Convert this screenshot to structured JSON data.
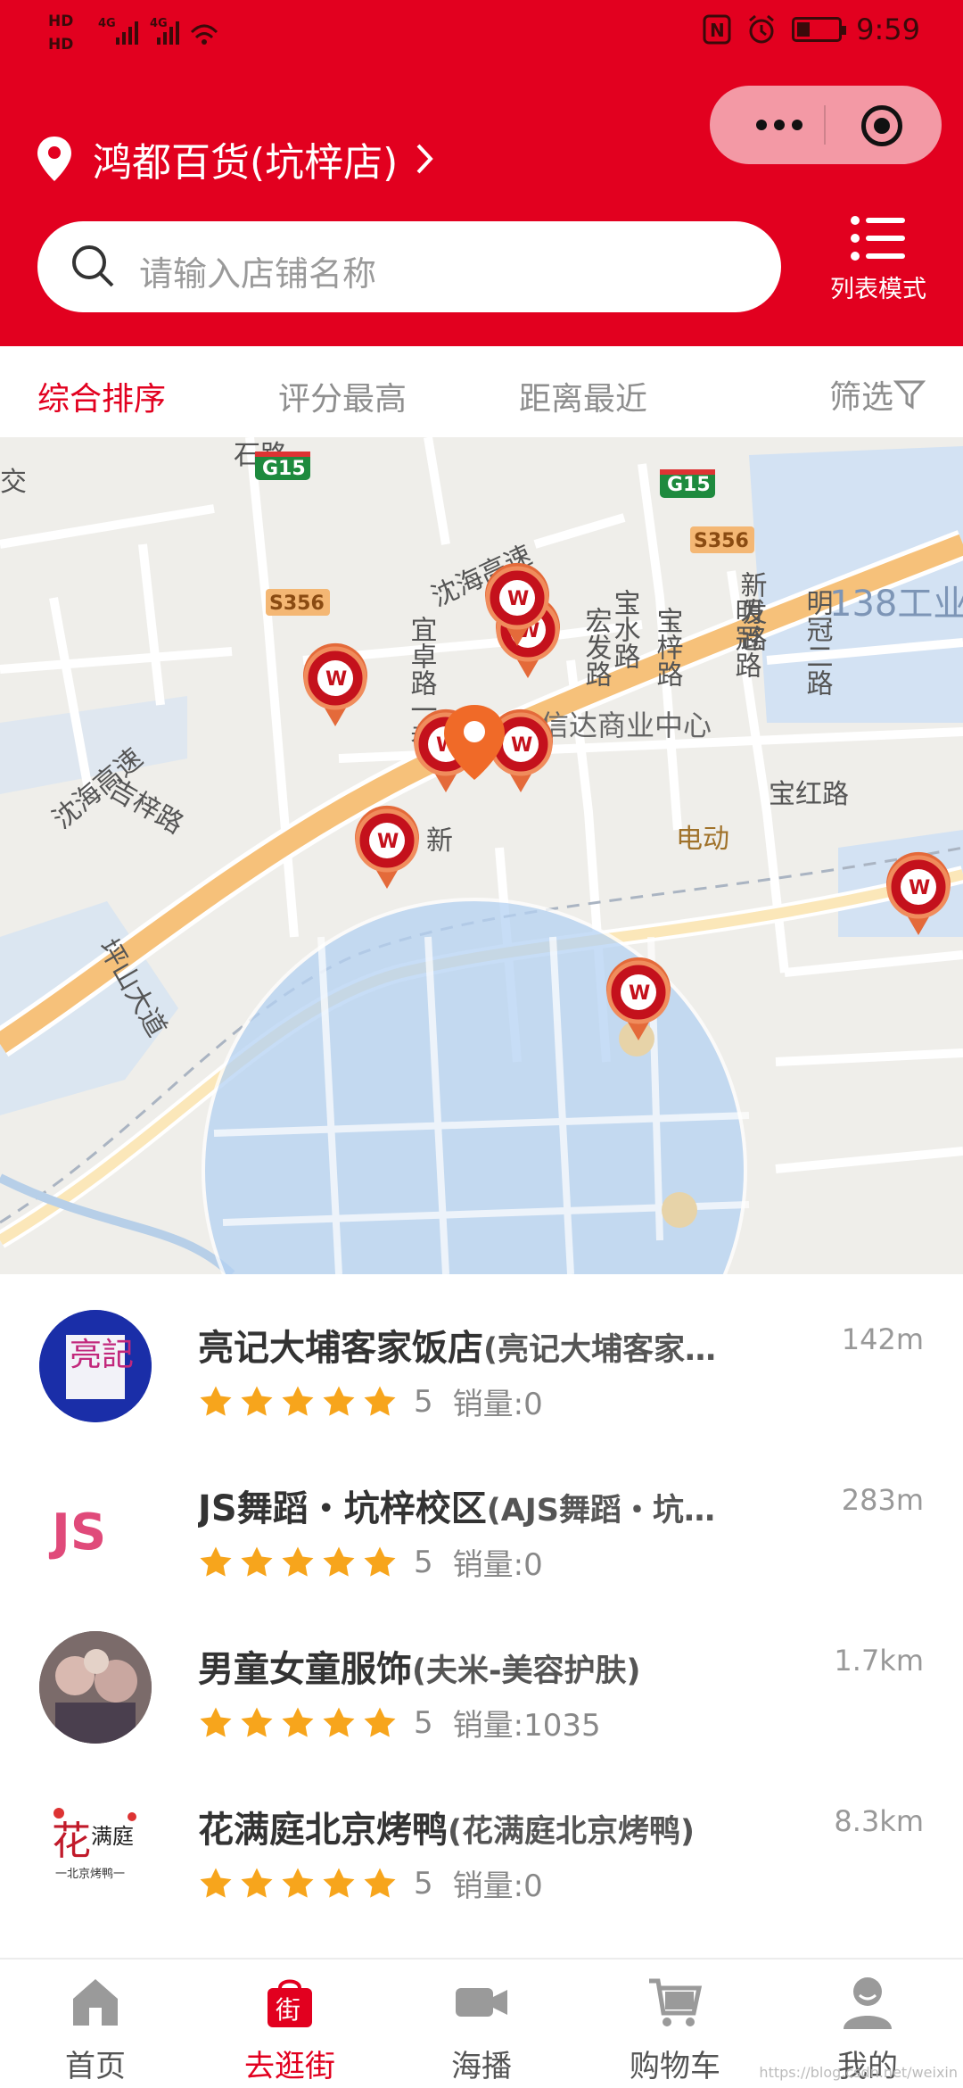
{
  "status_bar": {
    "left_tags": [
      "HD",
      "HD"
    ],
    "network": [
      "4G",
      "4G"
    ],
    "time": "9:59"
  },
  "header": {
    "store_name": "鸿都百货(坑梓店)",
    "search_placeholder": "请输入店铺名称",
    "list_mode_label": "列表模式",
    "brand_color": "#e2001f"
  },
  "sort_tabs": [
    {
      "label": "综合排序",
      "active": true
    },
    {
      "label": "评分最高",
      "active": false
    },
    {
      "label": "距离最近",
      "active": false
    }
  ],
  "filter_label": "筛选",
  "map": {
    "labels": {
      "shihai_1": "沈海高速",
      "shihai_2": "沈海高速",
      "g15_a": "G15",
      "g15_b": "G15",
      "s356_a": "S356",
      "s356_b": "S356",
      "industry": "138工业",
      "shi": "石路",
      "baoshui": "宝水路",
      "xinfa": "新发路",
      "yizhuo": "宜卓路一巷",
      "hongfa": "宏发路",
      "baozi": "宝梓路",
      "mingguan": "明冠路",
      "mingguan2": "明冠二路",
      "xinda": "信达商业中心",
      "baohong": "宝红路",
      "pingshan": "坪山大道",
      "jizi": "吉梓路",
      "xin": "新",
      "diandong": "电动",
      "jiao": "交"
    }
  },
  "stores": [
    {
      "name": "亮记大埔客家饭店",
      "sub": "(亮记大埔客家…",
      "distance": "142m",
      "rating": "5",
      "sales": "销量:0"
    },
    {
      "name": "JS舞蹈・坑梓校区",
      "sub": "(AJS舞蹈・坑…",
      "distance": "283m",
      "rating": "5",
      "sales": "销量:0"
    },
    {
      "name": "男童女童服饰",
      "sub": "(夫米-美容护肤)",
      "distance": "1.7km",
      "rating": "5",
      "sales": "销量:1035"
    },
    {
      "name": "花满庭北京烤鸭",
      "sub": "(花满庭北京烤鸭)",
      "distance": "8.3km",
      "rating": "5",
      "sales": "销量:0"
    }
  ],
  "avatar_text": {
    "s0": "亮記",
    "s1": "JS",
    "s3a": "花",
    "s3b": "满庭",
    "s3c": "一北京烤鸭一"
  },
  "bottom_nav": [
    {
      "label": "首页",
      "icon": "home-icon",
      "active": false
    },
    {
      "label": "去逛街",
      "icon": "shopping-bag-icon",
      "active": true
    },
    {
      "label": "海播",
      "icon": "video-camera-icon",
      "active": false
    },
    {
      "label": "购物车",
      "icon": "cart-icon",
      "active": false
    },
    {
      "label": "我的",
      "icon": "user-icon",
      "active": false
    }
  ],
  "nav_bag_glyph": "街",
  "watermark": "https://blog.csdn.net/weixin"
}
